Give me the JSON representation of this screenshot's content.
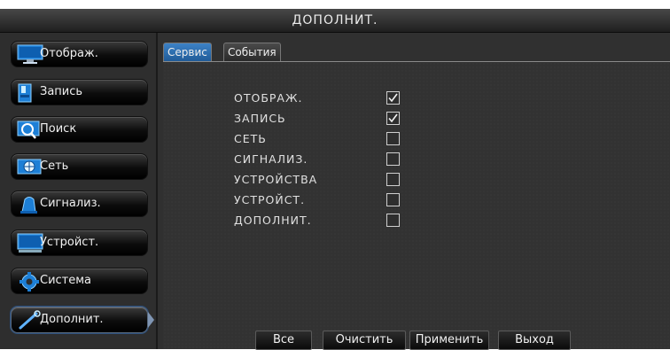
{
  "title": "ДОПОЛНИТ.",
  "sidebar": {
    "items": [
      {
        "label": "Отображ.",
        "icon": "monitor-icon"
      },
      {
        "label": "Запись",
        "icon": "recorder-icon"
      },
      {
        "label": "Поиск",
        "icon": "magnifier-icon"
      },
      {
        "label": "Сеть",
        "icon": "network-icon"
      },
      {
        "label": "Сигнализ.",
        "icon": "alarm-icon"
      },
      {
        "label": "Устройст.",
        "icon": "device-icon"
      },
      {
        "label": "Система",
        "icon": "gear-icon"
      },
      {
        "label": "Дополнит.",
        "icon": "wrench-icon",
        "active": true
      }
    ]
  },
  "tabs": [
    {
      "label": "Сервис",
      "active": true
    },
    {
      "label": "События",
      "active": false
    }
  ],
  "options": [
    {
      "label": "ОТОБРАЖ.",
      "checked": true
    },
    {
      "label": "ЗАПИСЬ",
      "checked": true
    },
    {
      "label": "СЕТЬ",
      "checked": false
    },
    {
      "label": "СИГНАЛИЗ.",
      "checked": false
    },
    {
      "label": "УСТРОЙСТВА",
      "checked": false
    },
    {
      "label": "УСТРОЙСТ.",
      "checked": false
    },
    {
      "label": "ДОПОЛНИТ.",
      "checked": false
    }
  ],
  "buttons": {
    "all": "Все",
    "clear": "Очистить",
    "apply": "Применить",
    "exit": "Выход"
  },
  "colors": {
    "accent": "#2b6fb3",
    "icon_blue": "#1d7fd6",
    "background": "#2e2e2e"
  }
}
